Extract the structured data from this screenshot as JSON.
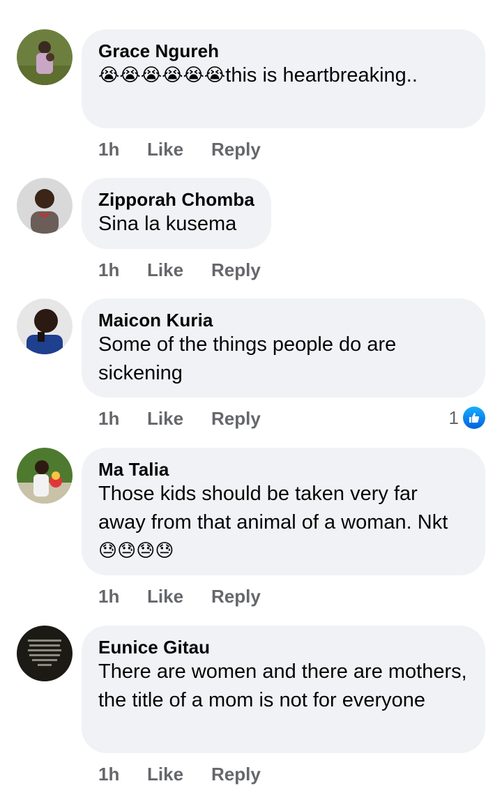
{
  "comments": [
    {
      "author": "Grace Ngureh",
      "emoji": "😭😭😭😭😭😭",
      "text": "this is heartbreaking..",
      "time": "1h",
      "like_label": "Like",
      "reply_label": "Reply"
    },
    {
      "author": "Zipporah Chomba",
      "text": "Sina la kusema",
      "time": "1h",
      "like_label": "Like",
      "reply_label": "Reply"
    },
    {
      "author": "Maicon Kuria",
      "text": "Some of the things people do are sickening",
      "time": "1h",
      "like_label": "Like",
      "reply_label": "Reply",
      "reaction_count": "1",
      "reaction_icon": "like-thumbs-up-icon"
    },
    {
      "author": "Ma Talia",
      "text": "Those kids should be taken very far away from that animal of a woman. Nkt",
      "emoji": "😓😓😓😓",
      "time": "1h",
      "like_label": "Like",
      "reply_label": "Reply"
    },
    {
      "author": "Eunice Gitau",
      "text": "There are women and there are mothers, the title of a mom is not for everyone",
      "time": "1h",
      "like_label": "Like",
      "reply_label": "Reply"
    }
  ],
  "colors": {
    "bubble": "#f0f2f5",
    "meta_text": "#65676b",
    "like_blue": "#1877f2"
  }
}
